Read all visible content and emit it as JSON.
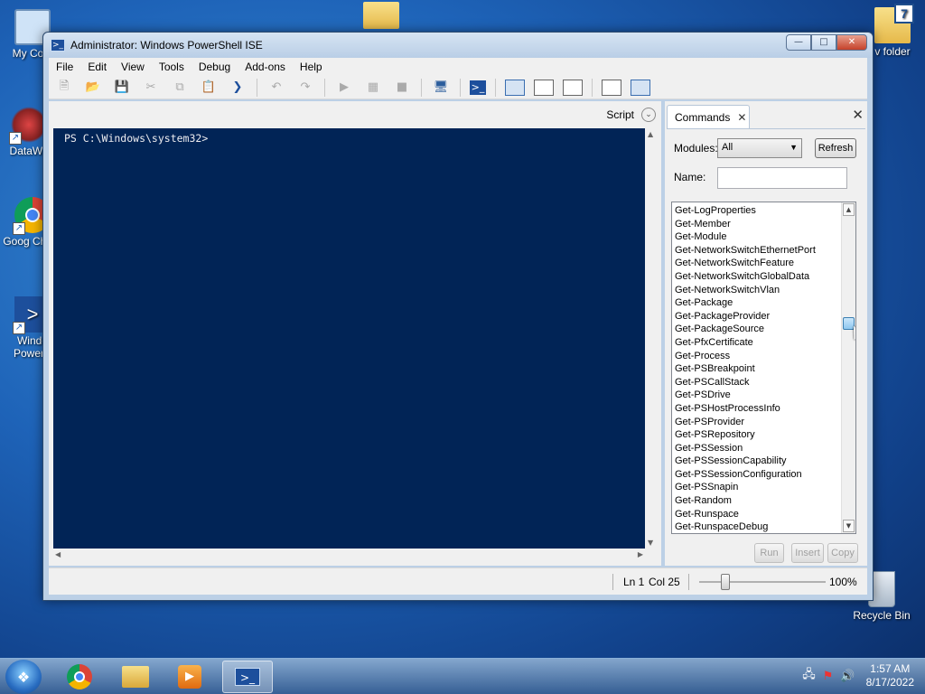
{
  "desktop": {
    "icons": [
      {
        "label": "My Com",
        "glyph": "🖥"
      },
      {
        "label": "DataWa",
        "glyph": "✳"
      },
      {
        "label": "Goog Chron",
        "glyph": "●"
      },
      {
        "label": "Windo PowerS",
        "glyph": ">_"
      },
      {
        "label": "",
        "glyph": "📁"
      },
      {
        "label": "v folder",
        "glyph": "📁"
      },
      {
        "label": "Recycle Bin",
        "glyph": "🗑"
      }
    ]
  },
  "window": {
    "title": "Administrator: Windows PowerShell ISE",
    "controls": {
      "minimize": "—",
      "maximize": "□",
      "close": "✕"
    }
  },
  "menu": [
    "File",
    "Edit",
    "View",
    "Tools",
    "Debug",
    "Add-ons",
    "Help"
  ],
  "toolbar": {
    "icons": [
      "new-icon",
      "open-icon",
      "save-icon",
      "cut-icon",
      "copy-icon",
      "paste-icon",
      "powershell-icon",
      "undo-icon",
      "redo-icon",
      "run-icon",
      "run-selection-icon",
      "stop-icon",
      "remote-icon",
      "powershell-tab-icon",
      "layout-top-icon",
      "layout-right-icon",
      "layout-max-icon",
      "show-script-icon",
      "show-commands-icon"
    ]
  },
  "script_pane": {
    "toggle_label": "Script",
    "console_prompt": "PS C:\\Windows\\system32>"
  },
  "commands_pane": {
    "tab_label": "Commands",
    "modules_label": "Modules:",
    "modules_value": "All",
    "refresh_label": "Refresh",
    "name_label": "Name:",
    "name_value": "",
    "commands": [
      "Get-LogProperties",
      "Get-Member",
      "Get-Module",
      "Get-NetworkSwitchEthernetPort",
      "Get-NetworkSwitchFeature",
      "Get-NetworkSwitchGlobalData",
      "Get-NetworkSwitchVlan",
      "Get-Package",
      "Get-PackageProvider",
      "Get-PackageSource",
      "Get-PfxCertificate",
      "Get-Process",
      "Get-PSBreakpoint",
      "Get-PSCallStack",
      "Get-PSDrive",
      "Get-PSHostProcessInfo",
      "Get-PSProvider",
      "Get-PSRepository",
      "Get-PSSession",
      "Get-PSSessionCapability",
      "Get-PSSessionConfiguration",
      "Get-PSSnapin",
      "Get-Random",
      "Get-Runspace",
      "Get-RunspaceDebug"
    ],
    "run_label": "Run",
    "insert_label": "Insert",
    "copy_label": "Copy"
  },
  "statusbar": {
    "line": "Ln 1",
    "col": "Col 25",
    "zoom": "100%"
  },
  "taskbar": {
    "clock_time": "1:57 AM",
    "clock_date": "8/17/2022"
  }
}
